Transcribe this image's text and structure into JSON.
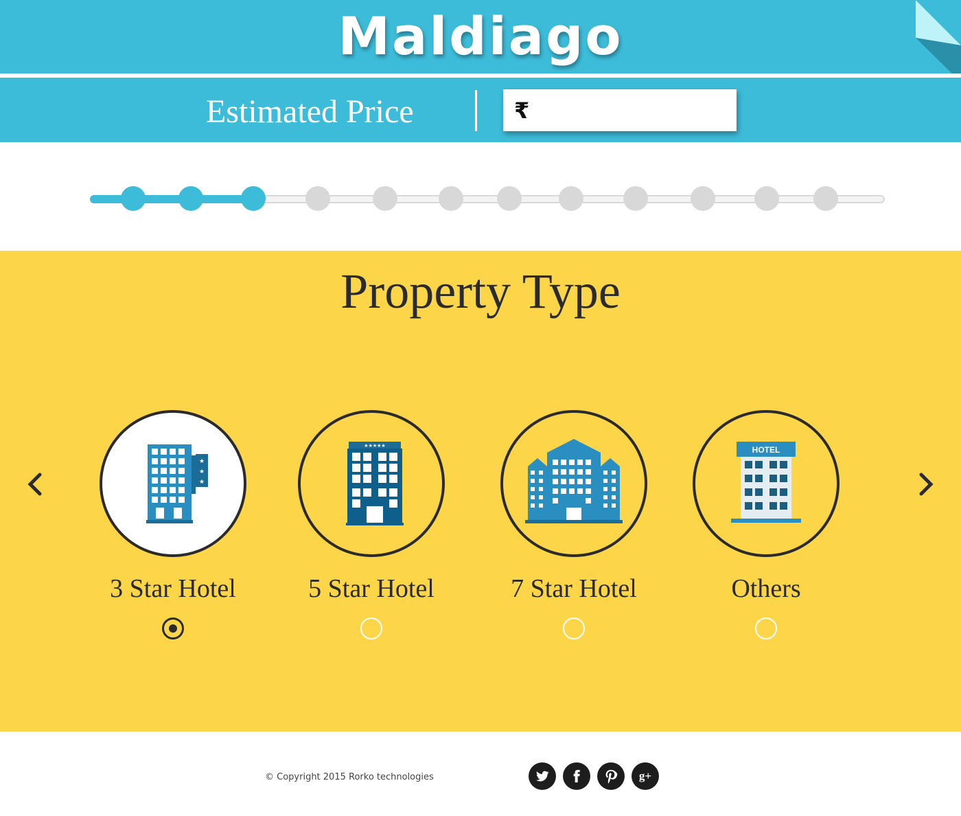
{
  "header": {
    "brand": "Maldiago",
    "estimated_price_label": "Estimated Price",
    "currency_symbol": "₹",
    "price_value": ""
  },
  "progress": {
    "total_steps": 12,
    "completed_steps": 3
  },
  "property": {
    "title": "Property Type",
    "options": [
      {
        "label": "3 Star Hotel",
        "icon": "three-star-hotel-icon",
        "selected": true
      },
      {
        "label": "5 Star Hotel",
        "icon": "five-star-hotel-icon",
        "selected": false
      },
      {
        "label": "7 Star Hotel",
        "icon": "seven-star-hotel-icon",
        "selected": false
      },
      {
        "label": "Others",
        "icon": "other-hotel-icon",
        "selected": false
      },
      {
        "hotel_sign": "HOTEL"
      }
    ]
  },
  "footer": {
    "copyright": "© Copyright 2015 Rorko technologies",
    "social": [
      "twitter-icon",
      "facebook-icon",
      "pinterest-icon",
      "google-plus-icon"
    ]
  },
  "colors": {
    "primary": "#3dbcd9",
    "accent": "#fdd549",
    "dark": "#2b2b2b",
    "building": "#1b6d97"
  }
}
